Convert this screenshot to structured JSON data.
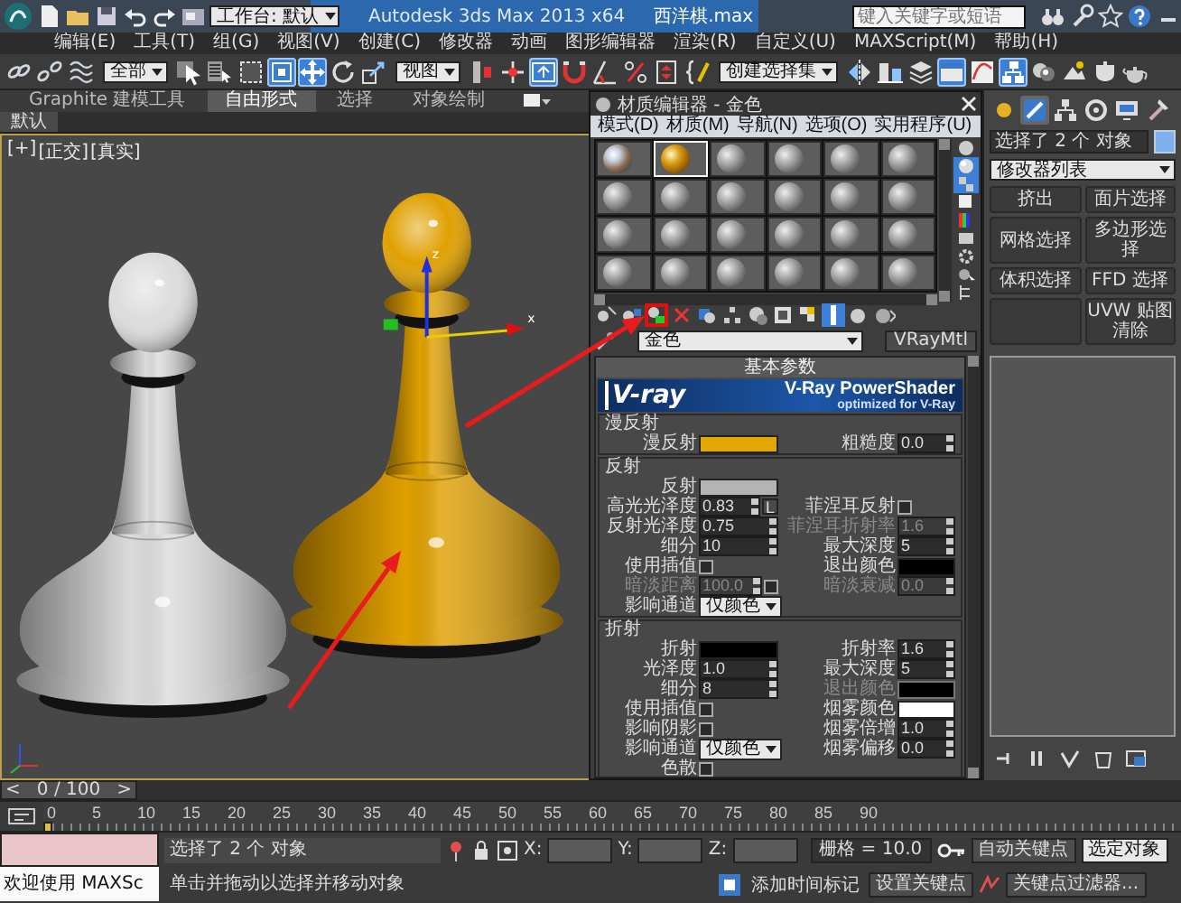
{
  "title_bar": {
    "workspace": "工作台: 默认",
    "app_title": "Autodesk 3ds Max 2013 x64",
    "file_name": "西洋棋.max",
    "search": {
      "placeholder": "键入关键字或短语"
    }
  },
  "menu_bar": [
    "编辑(E)",
    "工具(T)",
    "组(G)",
    "视图(V)",
    "创建(C)",
    "修改器",
    "动画",
    "图形编辑器",
    "渲染(R)",
    "自定义(U)",
    "MAXScript(M)",
    "帮助(H)"
  ],
  "toolbar": [
    {
      "kind": "icon",
      "active": false
    },
    {
      "kind": "icon",
      "active": false
    },
    {
      "kind": "icon",
      "active": false
    },
    {
      "kind": "dropdown",
      "value": "全部"
    },
    {
      "kind": "icon",
      "active": false
    },
    {
      "kind": "icon",
      "active": false
    },
    {
      "kind": "icon",
      "active": false
    },
    {
      "kind": "icon",
      "active": true
    },
    {
      "kind": "icon",
      "active": true
    },
    {
      "kind": "icon",
      "active": false
    },
    {
      "kind": "icon",
      "active": false
    },
    {
      "kind": "dropdown",
      "value": "视图"
    },
    {
      "kind": "icon",
      "active": false
    },
    {
      "kind": "icon",
      "active": false
    },
    {
      "kind": "icon",
      "active": true
    },
    {
      "kind": "icon",
      "active": false
    },
    {
      "kind": "icon",
      "active": false
    },
    {
      "kind": "icon",
      "active": false
    },
    {
      "kind": "icon",
      "active": false
    },
    {
      "kind": "icon",
      "active": false
    },
    {
      "kind": "dropdown",
      "value": "创建选择集"
    },
    {
      "kind": "icon",
      "active": false
    },
    {
      "kind": "icon",
      "active": false
    },
    {
      "kind": "icon",
      "active": false
    },
    {
      "kind": "icon",
      "active": true
    },
    {
      "kind": "icon",
      "active": false
    },
    {
      "kind": "icon",
      "active": true
    },
    {
      "kind": "icon",
      "active": false
    },
    {
      "kind": "icon",
      "active": false
    },
    {
      "kind": "icon",
      "active": false
    },
    {
      "kind": "icon",
      "active": false
    }
  ],
  "ribbon": {
    "tabs": [
      {
        "label": "Graphite 建模工具",
        "selected": false
      },
      {
        "label": "自由形式",
        "selected": true
      },
      {
        "label": "选择",
        "selected": false
      },
      {
        "label": "对象绘制",
        "selected": false
      }
    ],
    "panel_label": "默认"
  },
  "viewport": {
    "labels": [
      "[+]",
      "[正交]",
      "[真实]"
    ],
    "gizmo_labels": [
      "z",
      "x"
    ],
    "objects": [
      {
        "kind": "pawn",
        "color": "#dcdcdc",
        "selected": false
      },
      {
        "kind": "pawn",
        "color": "#e0a000",
        "selected": true
      }
    ]
  },
  "material_editor": {
    "title": "材质编辑器 - 金色",
    "menu": [
      "模式(D)",
      "材质(M)",
      "导航(N)",
      "选项(O)",
      "实用程序(U)"
    ],
    "slots": [
      {
        "kind": "reflective",
        "selected": false
      },
      {
        "kind": "gold",
        "selected": true
      },
      {
        "kind": "blank",
        "selected": false
      },
      {
        "kind": "blank",
        "selected": false
      },
      {
        "kind": "blank",
        "selected": false
      },
      {
        "kind": "blank",
        "selected": false
      },
      {
        "kind": "blank",
        "selected": false
      },
      {
        "kind": "blank",
        "selected": false
      },
      {
        "kind": "blank",
        "selected": false
      },
      {
        "kind": "blank",
        "selected": false
      },
      {
        "kind": "blank",
        "selected": false
      },
      {
        "kind": "blank",
        "selected": false
      },
      {
        "kind": "blank",
        "selected": false
      },
      {
        "kind": "blank",
        "selected": false
      },
      {
        "kind": "blank",
        "selected": false
      },
      {
        "kind": "blank",
        "selected": false
      },
      {
        "kind": "blank",
        "selected": false
      },
      {
        "kind": "blank",
        "selected": false
      },
      {
        "kind": "blank",
        "selected": false
      },
      {
        "kind": "blank",
        "selected": false
      },
      {
        "kind": "blank",
        "selected": false
      },
      {
        "kind": "blank",
        "selected": false
      },
      {
        "kind": "blank",
        "selected": false
      },
      {
        "kind": "blank",
        "selected": false
      }
    ],
    "side_tools": [
      {
        "active": false
      },
      {
        "active": true
      },
      {
        "active": true
      },
      {
        "active": false
      },
      {
        "active": false
      },
      {
        "active": false
      },
      {
        "active": false
      },
      {
        "active": false
      },
      {
        "active": false
      }
    ],
    "tools": [
      {
        "active": false,
        "highlighted": false
      },
      {
        "active": false,
        "highlighted": false
      },
      {
        "active": false,
        "highlighted": true
      },
      {
        "active": false,
        "highlighted": false
      },
      {
        "active": false,
        "highlighted": false
      },
      {
        "active": false,
        "highlighted": false
      },
      {
        "active": false,
        "highlighted": false
      },
      {
        "active": false,
        "highlighted": false
      },
      {
        "active": false,
        "highlighted": false
      },
      {
        "active": true,
        "highlighted": false
      },
      {
        "active": false,
        "highlighted": false
      },
      {
        "active": false,
        "highlighted": false
      }
    ],
    "material_name": "金色",
    "material_type": "VRayMtl",
    "rollout": "基本参数",
    "banner": {
      "logo": "V-ray",
      "title": "V-Ray PowerShader",
      "subtitle": "optimized for V-Ray"
    },
    "sections": [
      {
        "title": "漫反射",
        "rows": [
          {
            "left": {
              "label": "漫反射",
              "kind": "swatch",
              "color": "#e0a800"
            },
            "right": {
              "label": "粗糙度",
              "kind": "spinner",
              "value": "0.0"
            }
          }
        ]
      },
      {
        "title": "反射",
        "rows": [
          {
            "left": {
              "label": "反射",
              "kind": "swatch",
              "color": "#b4b4b4"
            }
          },
          {
            "left": {
              "label": "高光光泽度",
              "kind": "spinner",
              "value": "0.83",
              "button": "L"
            },
            "right": {
              "label": "菲涅耳反射",
              "kind": "checkbox",
              "checked": false
            }
          },
          {
            "left": {
              "label": "反射光泽度",
              "kind": "spinner",
              "value": "0.75"
            },
            "right": {
              "label": "菲涅耳折射率",
              "kind": "spinner",
              "value": "1.6",
              "disabled": true
            }
          },
          {
            "left": {
              "label": "细分",
              "kind": "spinner",
              "value": "10"
            },
            "right": {
              "label": "最大深度",
              "kind": "spinner",
              "value": "5"
            }
          },
          {
            "left": {
              "label": "使用插值",
              "kind": "checkbox",
              "checked": false
            },
            "right": {
              "label": "退出颜色",
              "kind": "swatch",
              "color": "#000000"
            }
          },
          {
            "left": {
              "label": "暗淡距离",
              "kind": "spinner",
              "value": "100.0",
              "disabled": true,
              "checked": false
            },
            "right": {
              "label": "暗淡衰减",
              "kind": "spinner",
              "value": "0.0",
              "disabled": true
            }
          },
          {
            "left": {
              "label": "影响通道",
              "kind": "dropdown",
              "value": "仅颜色"
            }
          }
        ]
      },
      {
        "title": "折射",
        "rows": [
          {
            "left": {
              "label": "折射",
              "kind": "swatch",
              "color": "#000000"
            },
            "right": {
              "label": "折射率",
              "kind": "spinner",
              "value": "1.6"
            }
          },
          {
            "left": {
              "label": "光泽度",
              "kind": "spinner",
              "value": "1.0"
            },
            "right": {
              "label": "最大深度",
              "kind": "spinner",
              "value": "5"
            }
          },
          {
            "left": {
              "label": "细分",
              "kind": "spinner",
              "value": "8"
            },
            "right": {
              "label": "退出颜色",
              "kind": "swatch",
              "color": "#000000",
              "disabled": true
            }
          },
          {
            "left": {
              "label": "使用插值",
              "kind": "checkbox",
              "checked": false
            },
            "right": {
              "label": "烟雾颜色",
              "kind": "swatch",
              "color": "#ffffff"
            }
          },
          {
            "left": {
              "label": "影响阴影",
              "kind": "checkbox",
              "checked": false
            },
            "right": {
              "label": "烟雾倍增",
              "kind": "spinner",
              "value": "1.0"
            }
          },
          {
            "left": {
              "label": "影响通道",
              "kind": "dropdown",
              "value": "仅颜色"
            },
            "right": {
              "label": "烟雾偏移",
              "kind": "spinner",
              "value": "0.0"
            }
          },
          {
            "left": {
              "label": "色散",
              "kind": "checkbox",
              "checked": false
            }
          }
        ]
      }
    ]
  },
  "command_panel": {
    "tabs": [
      {
        "selected": false
      },
      {
        "selected": true
      },
      {
        "selected": false
      },
      {
        "selected": false
      },
      {
        "selected": false
      },
      {
        "selected": false
      }
    ],
    "object_name": "选择了 2 个 对象",
    "modifier_list": "修改器列表",
    "modifiers": [
      {
        "kind": "button",
        "label": "挤出"
      },
      {
        "kind": "button",
        "label": "面片选择"
      },
      {
        "kind": "button",
        "label": "网格选择"
      },
      {
        "kind": "button",
        "label": "多边形选择"
      },
      {
        "kind": "button",
        "label": "体积选择"
      },
      {
        "kind": "button",
        "label": "FFD 选择"
      },
      {
        "kind": "blank"
      },
      {
        "kind": "button",
        "label": "UVW 贴图清除"
      }
    ]
  },
  "timeline": {
    "time_slider": {
      "prev": "<",
      "label": "0 / 100",
      "next": ">",
      "level": 0
    },
    "ticks": [
      "0",
      "5",
      "10",
      "15",
      "20",
      "25",
      "30",
      "35",
      "40",
      "45",
      "50",
      "55",
      "60",
      "65",
      "70",
      "75",
      "80",
      "85",
      "90"
    ]
  },
  "status_bar": {
    "listener": "欢迎使用 MAXSc",
    "selection": "选择了 2 个 对象",
    "prompt": "单击并拖动以选择并移动对象",
    "coords": [
      "X:",
      "Y:",
      "Z:"
    ],
    "grid": "栅格 = 10.0",
    "auto_key": "自动关键点",
    "key_mode": "选定对象",
    "add_time_tag": "添加时间标记",
    "set_key": "设置关键点",
    "key_filters": "关键点过滤器..."
  }
}
